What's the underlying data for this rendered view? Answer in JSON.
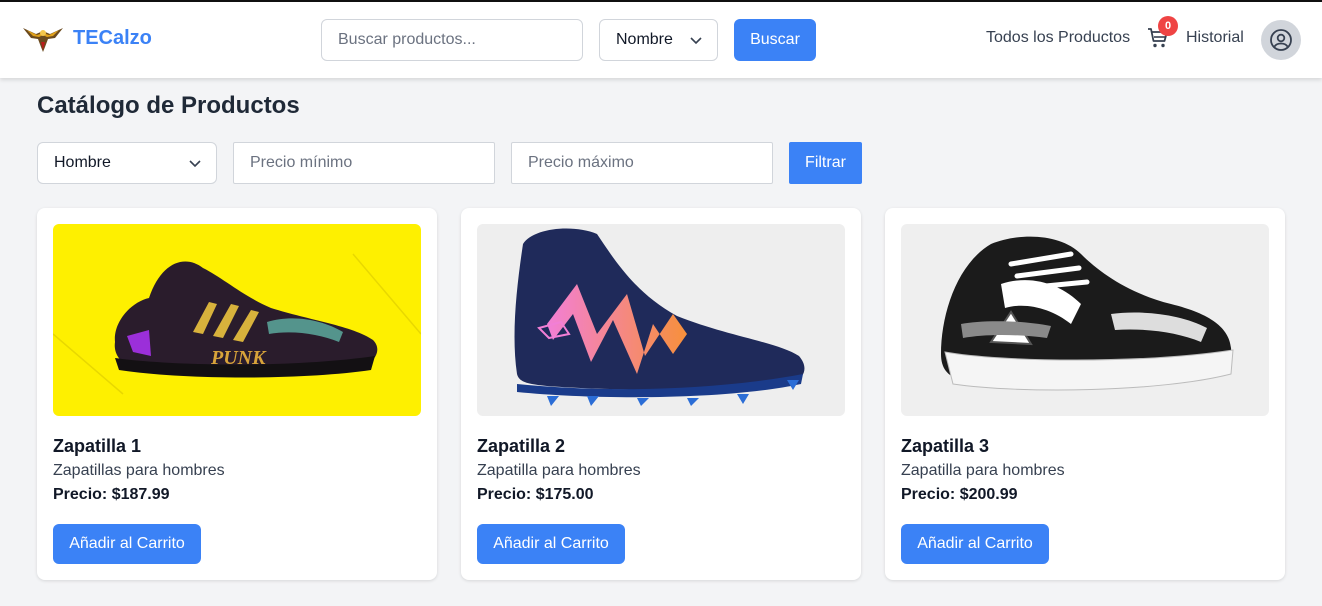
{
  "brand": {
    "name": "TECalzo"
  },
  "header": {
    "search_placeholder": "Buscar productos...",
    "search_by": "Nombre",
    "search_button": "Buscar",
    "nav_all_products": "Todos los Productos",
    "cart_count": "0",
    "nav_history": "Historial"
  },
  "main": {
    "title": "Catálogo de Productos",
    "filters": {
      "category": "Hombre",
      "min_price_placeholder": "Precio mínimo",
      "max_price_placeholder": "Precio máximo",
      "filter_button": "Filtrar"
    },
    "products": [
      {
        "name": "Zapatilla 1",
        "description": "Zapatillas para hombres",
        "price": "Precio: $187.99",
        "button": "Añadir al Carrito"
      },
      {
        "name": "Zapatilla 2",
        "description": "Zapatilla para hombres",
        "price": "Precio: $175.00",
        "button": "Añadir al Carrito"
      },
      {
        "name": "Zapatilla 3",
        "description": "Zapatilla para hombres",
        "price": "Precio: $200.99",
        "button": "Añadir al Carrito"
      }
    ]
  },
  "colors": {
    "accent": "#3b82f6",
    "badge": "#ef4444",
    "background": "#f3f4f6"
  },
  "icons": [
    "bird-logo-icon",
    "chevron-down-icon",
    "cart-icon",
    "user-circle-icon"
  ]
}
